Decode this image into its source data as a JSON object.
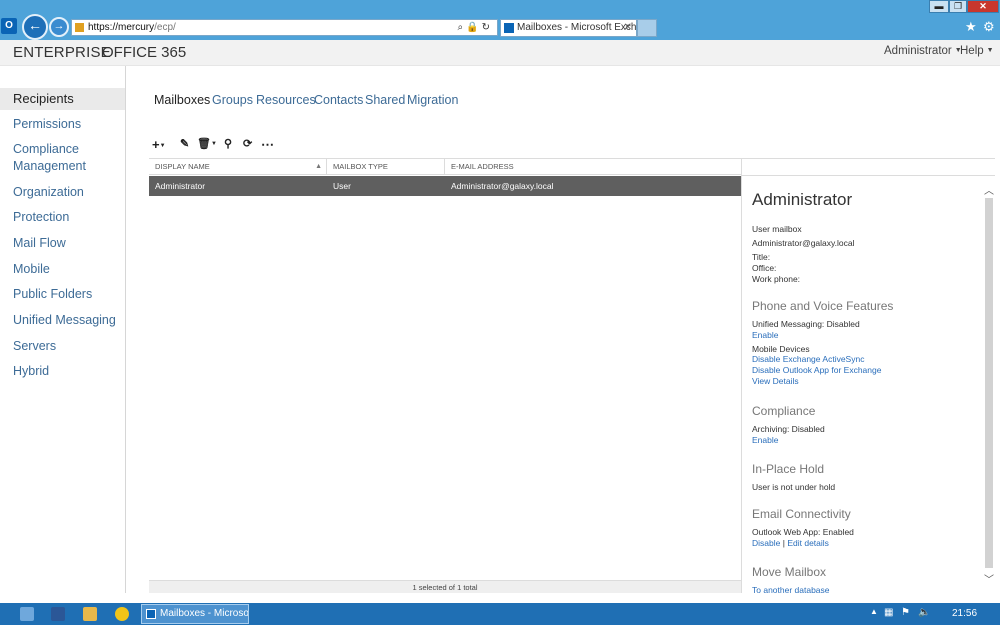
{
  "browser": {
    "window_buttons": {
      "minimize": "▬",
      "maximize": "❐",
      "close": "✕"
    },
    "url_host": "https://mercury",
    "url_path": "/ecp/",
    "tab_title": "Mailboxes - Microsoft Exch...",
    "tab_close": "✕",
    "icons": [
      "outlook-icon",
      "back-icon",
      "forward-icon",
      "search-icon",
      "lock-icon",
      "refresh-icon",
      "star-icon",
      "gear-icon"
    ]
  },
  "topbar": {
    "brand_enterprise": "ENTERPRISE",
    "brand_office365": "OFFICE 365",
    "user": "Administrator",
    "help": "Help"
  },
  "nav": {
    "items": [
      {
        "label": "Recipients",
        "active": true
      },
      {
        "label": "Permissions"
      },
      {
        "label": "Compliance Management"
      },
      {
        "label": "Organization"
      },
      {
        "label": "Protection"
      },
      {
        "label": "Mail Flow"
      },
      {
        "label": "Mobile"
      },
      {
        "label": "Public Folders"
      },
      {
        "label": "Unified Messaging"
      },
      {
        "label": "Servers"
      },
      {
        "label": "Hybrid"
      }
    ]
  },
  "tabs": [
    "Mailboxes",
    "Groups",
    "Resources",
    "Contacts",
    "Shared",
    "Migration"
  ],
  "table": {
    "columns": [
      "DISPLAY NAME",
      "MAILBOX TYPE",
      "E-MAIL ADDRESS"
    ],
    "rows": [
      {
        "name": "Administrator",
        "type": "User",
        "email": "Administrator@galaxy.local",
        "selected": true
      }
    ],
    "footer": "1 selected of 1 total"
  },
  "details": {
    "title": "Administrator",
    "mailbox_kind": "User mailbox",
    "email": "Administrator@galaxy.local",
    "title_label": "Title:",
    "office_label": "Office:",
    "phone_label": "Work phone:",
    "phone_section": "Phone and Voice Features",
    "um_status": "Unified Messaging: Disabled",
    "um_enable": "Enable",
    "mobile_devices": "Mobile Devices",
    "disable_eas": "Disable Exchange ActiveSync",
    "disable_owa_app": "Disable Outlook App for Exchange",
    "view_details": "View Details",
    "compliance_section": "Compliance",
    "archiving_status": "Archiving: Disabled",
    "archiving_enable": "Enable",
    "hold_section": "In-Place Hold",
    "hold_status": "User is not under hold",
    "email_section": "Email Connectivity",
    "owa_status": "Outlook Web App: Enabled",
    "owa_disable": "Disable",
    "separator": "|",
    "owa_edit": "Edit details",
    "move_section": "Move Mailbox",
    "move_link": "To another database"
  },
  "taskbar": {
    "window_label": "Mailboxes - Microsof...",
    "clock": "21:56"
  },
  "colors": {
    "chrome_blue": "#4ea3d9",
    "link_blue": "#2a6ebb",
    "nav_blue": "#3d6b96",
    "selected_row": "#5f5f5f",
    "taskbar": "#1f6fb4"
  }
}
